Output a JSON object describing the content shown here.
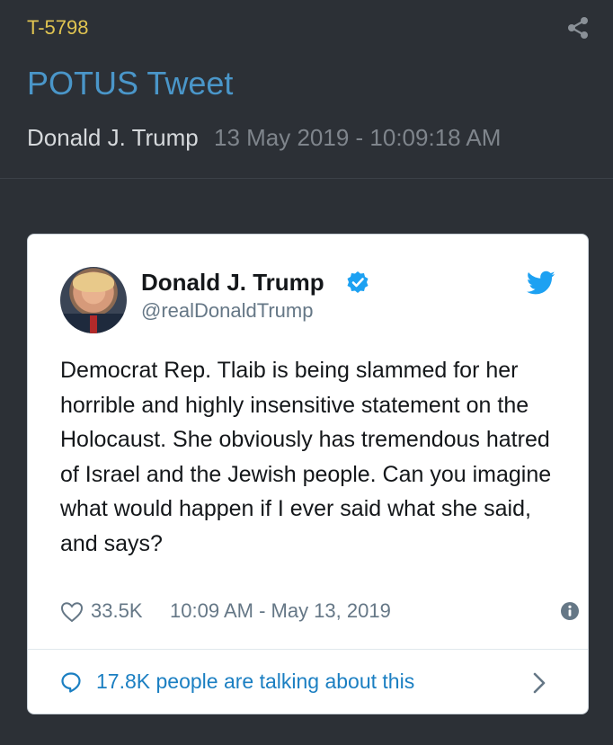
{
  "header": {
    "tag": "T-5798",
    "title": "POTUS Tweet",
    "author": "Donald J. Trump",
    "date": "13 May 2019 - 10:09:18 AM"
  },
  "tweet": {
    "name": "Donald J. Trump",
    "handle": "@realDonaldTrump",
    "text": "Democrat Rep. Tlaib is being slammed for her horrible and highly insensitive statement on the Holocaust. She obviously has tremendous hatred of Israel and the Jewish people. Can you imagine what would happen if I ever said what she said, and says?",
    "likes": "33.5K",
    "timestamp": "10:09 AM - May 13, 2019",
    "talking": "17.8K people are talking about this"
  },
  "colors": {
    "background": "#2c3036",
    "tag": "#e0c451",
    "title": "#4a96c9",
    "twitter_blue": "#1da1f2",
    "link_blue": "#1b7fc2"
  },
  "icons": {
    "share": "share-icon",
    "verified": "verified-badge-icon",
    "bird": "twitter-bird-icon",
    "like": "heart-icon",
    "info": "info-icon",
    "conversation": "speech-bubble-icon",
    "chevron": "chevron-right-icon"
  }
}
